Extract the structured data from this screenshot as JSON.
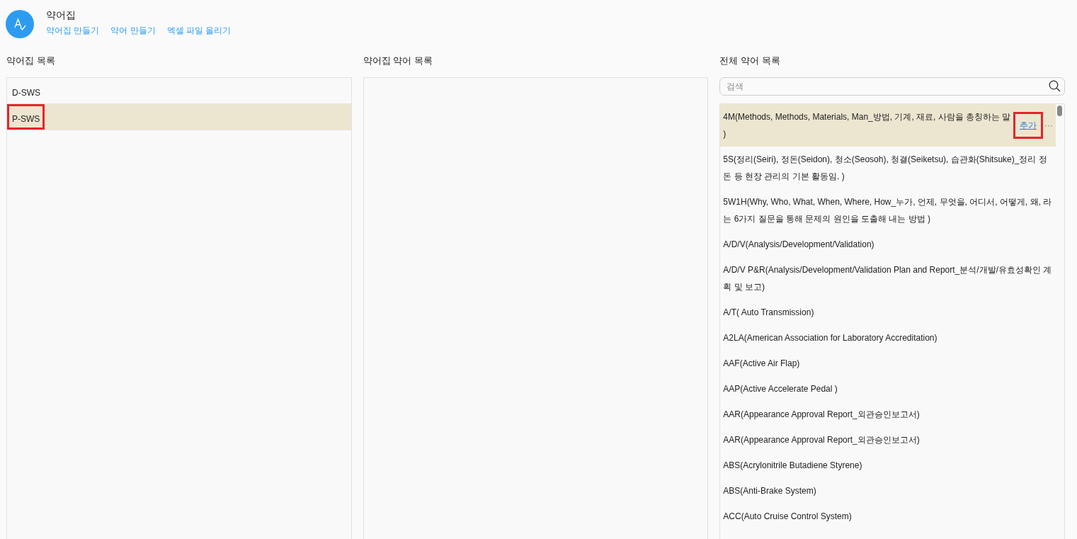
{
  "header": {
    "title": "약어집",
    "links": [
      "약어집 만들기",
      "약어 만들기",
      "엑셀 파일 올리기"
    ]
  },
  "glossary_list": {
    "title": "약어집 목록",
    "items": [
      {
        "label": "D-SWS",
        "selected": false,
        "annotated": false
      },
      {
        "label": "P-SWS",
        "selected": true,
        "annotated": true
      }
    ]
  },
  "glossary_terms": {
    "title": "약어집 약어 목록"
  },
  "all_terms": {
    "title": "전체 약어 목록",
    "search": {
      "placeholder": "검색"
    },
    "add_label": "추가",
    "add_annotated": true,
    "more_label": "···",
    "items": [
      {
        "text": "4M(Methods, Methods, Materials, Man_방법, 기계, 재료, 사람을 총칭하는 말 )",
        "selected": true
      },
      {
        "text": "5S(정리(Seiri), 정돈(Seidon), 청소(Seosoh), 청결(Seiketsu), 습관화(Shitsuke)_정리 정돈 등 현장 관리의 기본 활동임. )",
        "selected": false
      },
      {
        "text": "5W1H(Why, Who, What, When, Where, How_누가, 언제, 무엇을, 어디서, 어떻게, 왜, 라는 6가지 질문을 통해 문제의 원인을 도출해 내는 방법 )",
        "selected": false
      },
      {
        "text": "A/D/V(Analysis/Development/Validation)",
        "selected": false
      },
      {
        "text": "A/D/V P&R(Analysis/Development/Validation Plan and Report_분석/개발/유효성확인 계획 및 보고)",
        "selected": false
      },
      {
        "text": "A/T( Auto Transmission)",
        "selected": false
      },
      {
        "text": "A2LA(American Association for Laboratory Accreditation)",
        "selected": false
      },
      {
        "text": "AAF(Active Air Flap)",
        "selected": false
      },
      {
        "text": "AAP(Active Accelerate Pedal )",
        "selected": false
      },
      {
        "text": "AAR(Appearance Approval Report_외관승인보고서)",
        "selected": false
      },
      {
        "text": "AAR(Appearance Approval Report_외관승인보고서)",
        "selected": false
      },
      {
        "text": "ABS(Acrylonitrile Butadiene Styrene)",
        "selected": false
      },
      {
        "text": "ABS(Anti-Brake System)",
        "selected": false
      },
      {
        "text": "ACC(Auto Cruise Control System)",
        "selected": false
      }
    ]
  }
}
